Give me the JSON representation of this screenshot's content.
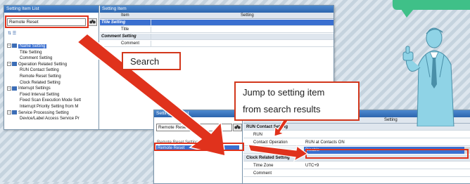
{
  "left_window": {
    "list_title": "Setting Item List",
    "view_title": "Setting Item",
    "search_value": "Remote Reset",
    "search_icon": "binoculars-icon",
    "grid_headers": [
      "Item",
      "Setting"
    ],
    "grid_rows": [
      {
        "label": "Title Setting",
        "type": "group-selected"
      },
      {
        "label": "Title",
        "type": "item"
      },
      {
        "label": "Comment Setting",
        "type": "group"
      },
      {
        "label": "Comment",
        "type": "item"
      }
    ],
    "tree": [
      {
        "label": "Name Setting",
        "level": 0,
        "selected": true
      },
      {
        "label": "Title Setting",
        "level": 1
      },
      {
        "label": "Comment Setting",
        "level": 1
      },
      {
        "label": "Operation Related Setting",
        "level": 0
      },
      {
        "label": "RUN Contact Setting",
        "level": 1
      },
      {
        "label": "Remote Reset Setting",
        "level": 1
      },
      {
        "label": "Clock Related Setting",
        "level": 1
      },
      {
        "label": "Interrupt Settings",
        "level": 0
      },
      {
        "label": "Fixed Interval Setting",
        "level": 1
      },
      {
        "label": "Fixed Scan Execution Mode Sett",
        "level": 1
      },
      {
        "label": "Interrupt Priority Setting from M",
        "level": 1
      },
      {
        "label": "Service Processing Setting",
        "level": 0
      },
      {
        "label": "Device/Label Access Service Pr",
        "level": 1
      }
    ]
  },
  "right_window": {
    "list_title": "Setting Item List",
    "search_value": "Remote Reset",
    "results": [
      "Remote Reset Setting",
      "Remote Reset"
    ],
    "view_header": "Setting",
    "grid_rows": [
      {
        "label": "RUN Contact Setting",
        "value": "",
        "type": "group"
      },
      {
        "label": "RUN",
        "value": "",
        "type": "item"
      },
      {
        "label": "Contact Operation",
        "value": "RUN at Contacts ON",
        "type": "item"
      },
      {
        "label": "Remote Reset",
        "value": "Disable",
        "type": "selected"
      },
      {
        "label": "Clock Related Setting",
        "value": "",
        "type": "group"
      },
      {
        "label": "Time Zone",
        "value": "UTC+9",
        "type": "item"
      },
      {
        "label": "Comment",
        "value": "",
        "type": "item"
      }
    ]
  },
  "callouts": {
    "search": "Search",
    "jump_line1": "Jump to setting item",
    "jump_line2": "from search results"
  },
  "colors": {
    "accent_red": "#e0321c",
    "title_blue": "#2c64ad",
    "select_blue": "#3a6fd0",
    "bubble_green": "#3fc088"
  }
}
